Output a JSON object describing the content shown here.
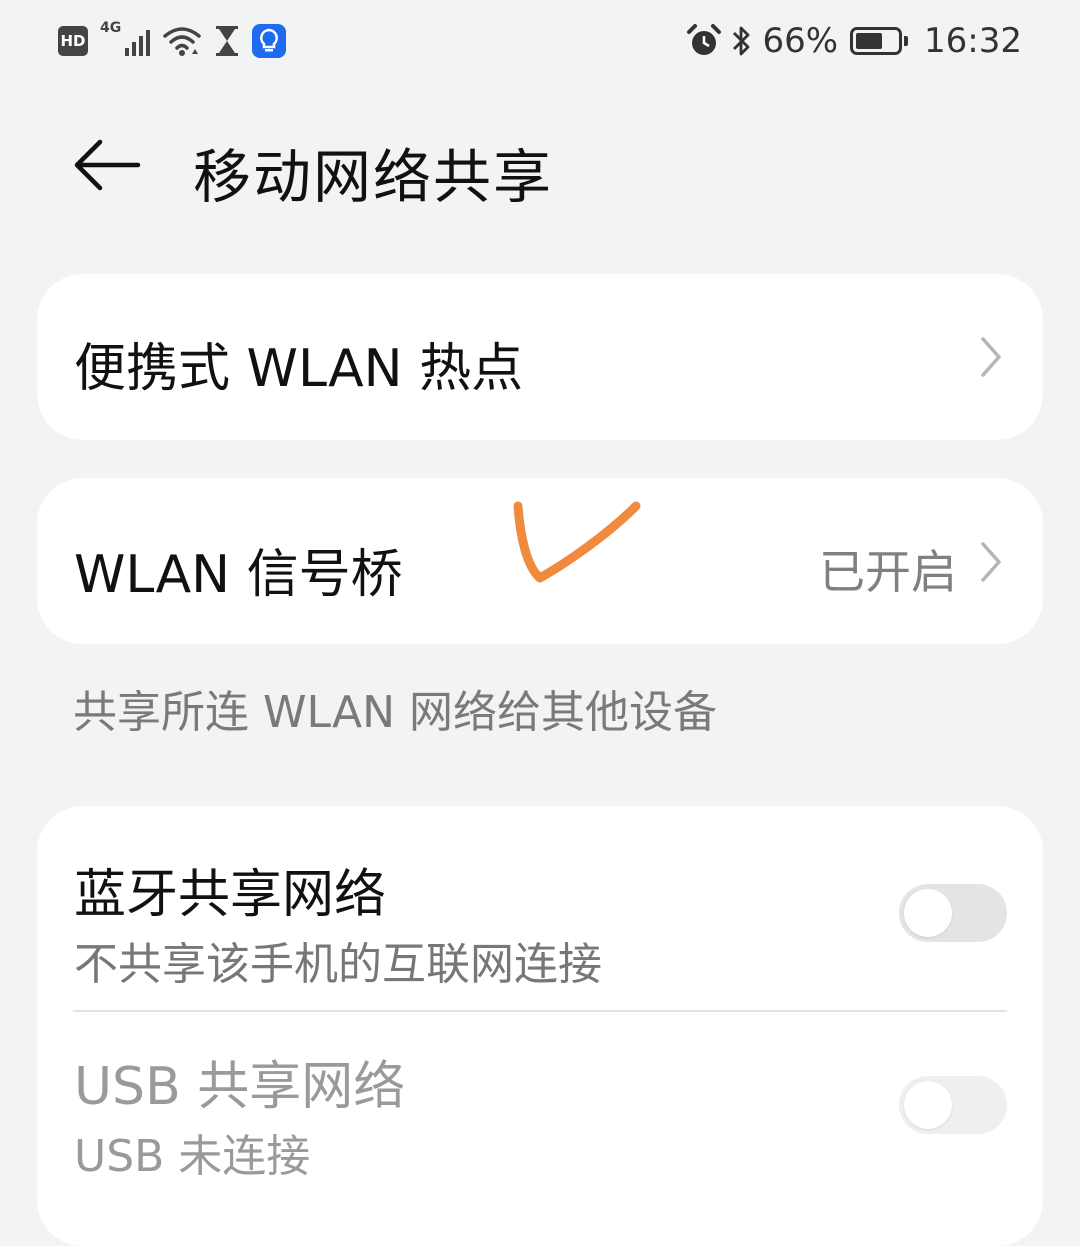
{
  "status_bar": {
    "hd_label": "HD",
    "network_label": "4G",
    "battery_percent": "66%",
    "battery_level": 0.66,
    "time": "16:32",
    "icons": [
      "hd-icon",
      "cellular-signal-icon",
      "wifi-icon",
      "hourglass-icon",
      "bulb-notification-icon",
      "alarm-icon",
      "bluetooth-icon",
      "battery-icon"
    ]
  },
  "header": {
    "title": "移动网络共享",
    "back_icon": "arrow-left-icon"
  },
  "hotspot": {
    "title": "便携式 WLAN 热点"
  },
  "wlan_bridge": {
    "title": "WLAN 信号桥",
    "value": "已开启",
    "caption": "共享所连 WLAN 网络给其他设备",
    "annotation_color": "#f08a3c"
  },
  "bluetooth_tethering": {
    "title": "蓝牙共享网络",
    "subtitle": "不共享该手机的互联网连接",
    "enabled": false
  },
  "usb_tethering": {
    "title": "USB 共享网络",
    "subtitle": "USB 未连接",
    "enabled": false,
    "available": false
  }
}
